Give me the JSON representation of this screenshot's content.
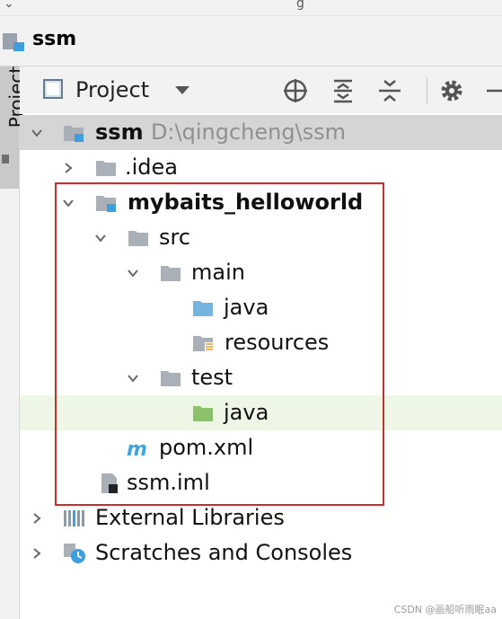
{
  "navbar": {
    "title": "ssm"
  },
  "side_tab": {
    "label": "Project"
  },
  "toolbar": {
    "view_label": "Project"
  },
  "tree": [
    {
      "label": "ssm",
      "path": "D:\\qingcheng\\ssm"
    },
    {
      "label": ".idea"
    },
    {
      "label": "mybaits_helloworld"
    },
    {
      "label": "src"
    },
    {
      "label": "main"
    },
    {
      "label": "java"
    },
    {
      "label": "resources"
    },
    {
      "label": "test"
    },
    {
      "label": "java"
    },
    {
      "label": "pom.xml"
    },
    {
      "label": "ssm.iml"
    },
    {
      "label": "External Libraries"
    },
    {
      "label": "Scratches and Consoles"
    }
  ],
  "colors": {
    "selection": "#d5d5d5",
    "hover": "#eef6e6",
    "highlight_box": "#d42a2a",
    "source_folder": "#74b4de",
    "test_folder": "#8cc26b",
    "folder": "#a9b0b8"
  },
  "watermark": "CSDN @画船听雨眠aa"
}
